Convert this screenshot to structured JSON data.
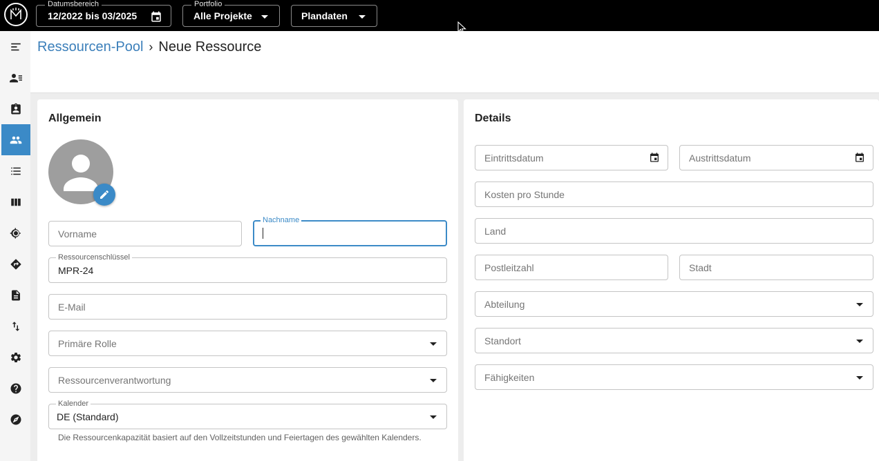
{
  "topbar": {
    "date_range_label": "Datumsbereich",
    "date_range_value": "12/2022 bis 03/2025",
    "portfolio_label": "Portfolio",
    "portfolio_value": "Alle Projekte",
    "plan_value": "Plandaten"
  },
  "breadcrumb": {
    "parent": "Ressourcen-Pool",
    "separator": "›",
    "current": "Neue Ressource"
  },
  "general": {
    "title": "Allgemein",
    "firstname_placeholder": "Vorname",
    "lastname_label": "Nachname",
    "lastname_value": "",
    "resource_key_label": "Ressourcenschlüssel",
    "resource_key_value": "MPR-24",
    "email_placeholder": "E-Mail",
    "primary_role_placeholder": "Primäre Rolle",
    "responsibility_placeholder": "Ressourcenverantwortung",
    "calendar_label": "Kalender",
    "calendar_value": "DE (Standard)",
    "calendar_helper": "Die Ressourcenkapazität basiert auf den Vollzeitstunden und Feiertagen des gewählten Kalenders."
  },
  "details": {
    "title": "Details",
    "entry_date_placeholder": "Eintrittsdatum",
    "exit_date_placeholder": "Austrittsdatum",
    "cost_placeholder": "Kosten pro Stunde",
    "country_placeholder": "Land",
    "zip_placeholder": "Postleitzahl",
    "city_placeholder": "Stadt",
    "department_placeholder": "Abteilung",
    "location_placeholder": "Standort",
    "skills_placeholder": "Fähigkeiten"
  },
  "sidebar": {
    "items": [
      {
        "icon": "menu-icon"
      },
      {
        "icon": "person-list-icon"
      },
      {
        "icon": "clipboard-person-icon"
      },
      {
        "icon": "people-icon",
        "active": true
      },
      {
        "icon": "list-icon"
      },
      {
        "icon": "columns-icon"
      },
      {
        "icon": "target-icon"
      },
      {
        "icon": "directions-icon"
      },
      {
        "icon": "document-icon"
      },
      {
        "icon": "swap-vert-icon"
      },
      {
        "icon": "gear-icon"
      },
      {
        "icon": "help-icon"
      },
      {
        "icon": "compass-icon"
      }
    ]
  },
  "colors": {
    "accent": "#3b8ac7",
    "link": "#3b7fba",
    "topbar": "#000000",
    "background": "#ededed"
  }
}
